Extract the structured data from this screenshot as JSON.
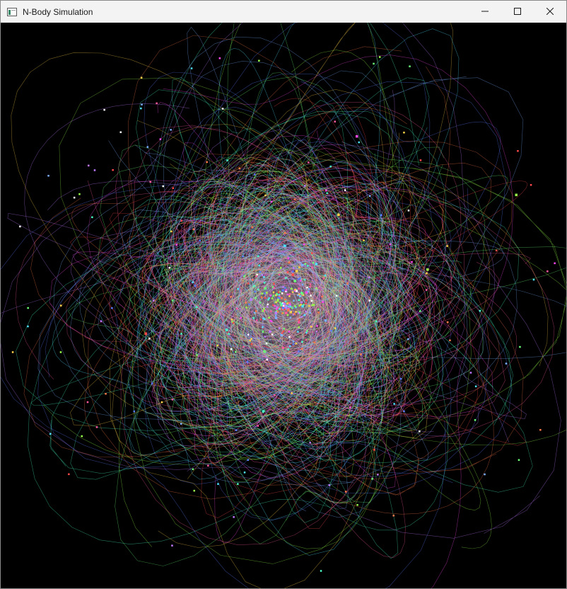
{
  "window": {
    "title": "N-Body Simulation",
    "icon": "app-window-icon",
    "controls": {
      "minimize_icon": "minimize-icon",
      "maximize_icon": "maximize-icon",
      "close_icon": "close-icon"
    }
  },
  "simulation": {
    "background": "#000000",
    "trail_colors": [
      "#5a7dff",
      "#ff5aa0",
      "#6cff7a",
      "#ffd24a",
      "#4fe3ff",
      "#c07aff",
      "#ff7a4a",
      "#9aff4a",
      "#ff4af0",
      "#4affc8",
      "#ff4a4a",
      "#7ab0ff"
    ],
    "core_color": "#ffffff"
  }
}
